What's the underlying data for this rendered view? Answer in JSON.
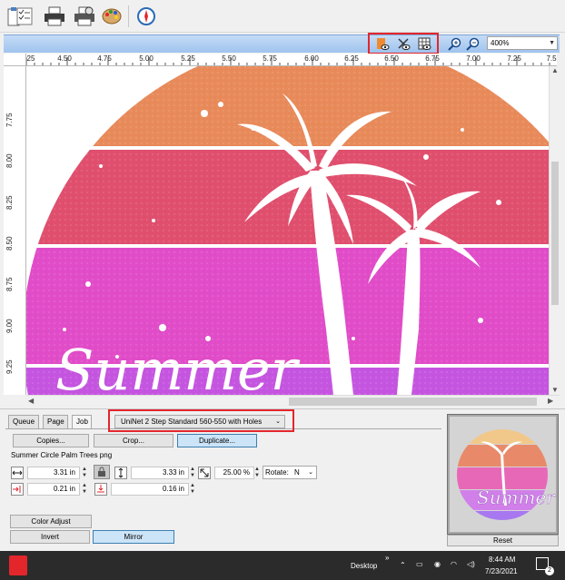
{
  "view": {
    "zoom_value": "400%"
  },
  "ruler": {
    "h_ticks": [
      "25",
      "4.50",
      "4.75",
      "5.00",
      "5.25",
      "5.50",
      "5.75",
      "6.00",
      "6.25",
      "6.50",
      "6.75",
      "7.00",
      "7.25",
      "7.5"
    ],
    "v_ticks": [
      "7.75",
      "8.00",
      "8.25",
      "8.50",
      "8.75",
      "9.00",
      "9.25"
    ]
  },
  "artwork": {
    "stripe_colors": [
      "#e88a5a",
      "#e04f6e",
      "#e14cc8",
      "#c555e0"
    ],
    "text_partial": "Summer"
  },
  "tabs": [
    {
      "label": "Queue"
    },
    {
      "label": "Page"
    },
    {
      "label": "Job"
    }
  ],
  "job": {
    "device_profile": "UniNet 2 Step Standard 560-550 with Holes",
    "copies_label": "Copies...",
    "crop_label": "Crop...",
    "duplicate_label": "Duplicate...",
    "file_name": "Summer Circle Palm Trees png",
    "width_value": "3.31 in",
    "height_value": "3.33 in",
    "scale_value": "25.00 %",
    "rotate_label": "Rotate:",
    "rotate_value": "N",
    "x_offset_value": "0.21 in",
    "y_offset_value": "0.16 in",
    "color_adjust_label": "Color Adjust",
    "invert_label": "Invert",
    "mirror_label": "Mirror"
  },
  "preview": {
    "reset_label": "Reset"
  },
  "taskbar": {
    "desktop_label": "Desktop",
    "time": "8:44 AM",
    "date": "7/23/2021",
    "notification_count": "2"
  }
}
